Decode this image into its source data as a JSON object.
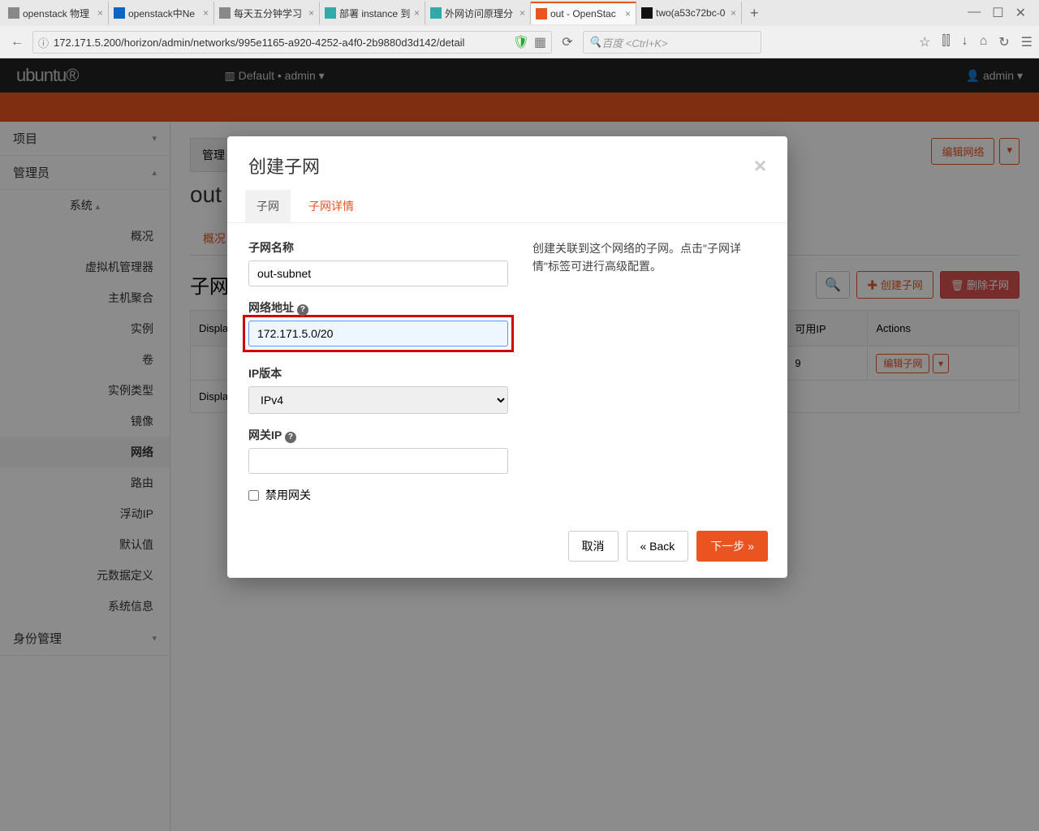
{
  "browser": {
    "tabs": [
      {
        "label": "openstack 物理"
      },
      {
        "label": "openstack中Ne"
      },
      {
        "label": "每天五分钟学习"
      },
      {
        "label": "部署 instance 到"
      },
      {
        "label": "外网访问原理分"
      },
      {
        "label": "out - OpenStac"
      },
      {
        "label": "two(a53c72bc-0"
      }
    ],
    "url": "172.171.5.200/horizon/admin/networks/995e1165-a920-4252-a4f0-2b9880d3d142/detail",
    "search_placeholder": "百度 <Ctrl+K>"
  },
  "topbar": {
    "logo": "ubuntu®",
    "domain": "Default • admin ▾",
    "user": "admin ▾"
  },
  "sidebar": {
    "project": "项目",
    "admin": "管理员",
    "system": "系统",
    "items": [
      "概况",
      "虚拟机管理器",
      "主机聚合",
      "实例",
      "卷",
      "实例类型",
      "镜像",
      "网络",
      "路由",
      "浮动IP",
      "默认值",
      "元数据定义",
      "系统信息"
    ],
    "identity": "身份管理"
  },
  "main": {
    "breadcrumb": "管理",
    "title": "out",
    "tab_overview": "概况",
    "subtitle": "子网",
    "btn_edit_network": "编辑网络",
    "btn_create_subnet": "创建子网",
    "btn_delete_subnet": "删除子网",
    "table_display": "Displa",
    "table_display2": "Displa",
    "col_available_ip": "可用IP",
    "col_actions": "Actions",
    "row_available_ip": "9",
    "row_action": "编辑子网"
  },
  "modal": {
    "title": "创建子网",
    "tab_subnet": "子网",
    "tab_detail": "子网详情",
    "label_name": "子网名称",
    "value_name": "out-subnet",
    "label_address": "网络地址",
    "value_address": "172.171.5.0/20",
    "label_ipversion": "IP版本",
    "value_ipversion": "IPv4",
    "label_gateway": "网关IP",
    "value_gateway": "",
    "checkbox_disable_gw": "禁用网关",
    "help": "创建关联到这个网络的子网。点击\"子网详情\"标签可进行高级配置。",
    "btn_cancel": "取消",
    "btn_back": "«  Back",
    "btn_next": "下一步  »"
  }
}
